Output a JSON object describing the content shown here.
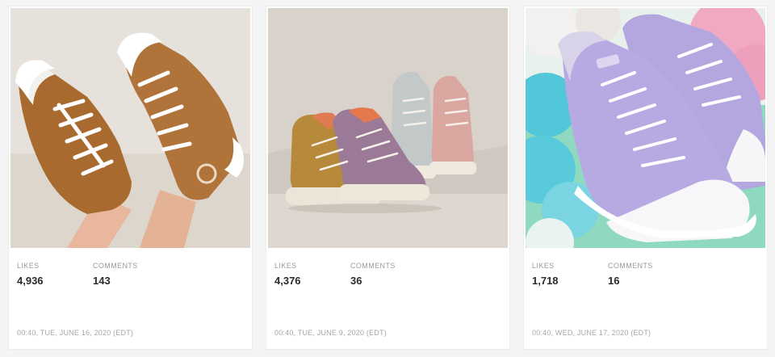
{
  "posts": [
    {
      "image_icon": "photo-brown-high-top-sneakers",
      "likes_label": "LIKES",
      "likes": "4,936",
      "comments_label": "COMMENTS",
      "comments": "143",
      "timestamp": "00:40, TUE, JUNE 16, 2020 (EDT)"
    },
    {
      "image_icon": "photo-pastel-high-top-sneakers",
      "likes_label": "LIKES",
      "likes": "4,376",
      "comments_label": "COMMENTS",
      "comments": "36",
      "timestamp": "00:40, TUE, JUNE 9, 2020 (EDT)"
    },
    {
      "image_icon": "photo-lavender-low-top-sneakers",
      "likes_label": "LIKES",
      "likes": "1,718",
      "comments_label": "COMMENTS",
      "comments": "16",
      "timestamp": "00:40, WED, JUNE 17, 2020 (EDT)"
    }
  ],
  "colors": {
    "page_background": "#f4f4f4",
    "card_background": "#ffffff",
    "label_text": "#9a9a9a",
    "value_text": "#2b2b2b",
    "timestamp_text": "#a6a6a6"
  }
}
